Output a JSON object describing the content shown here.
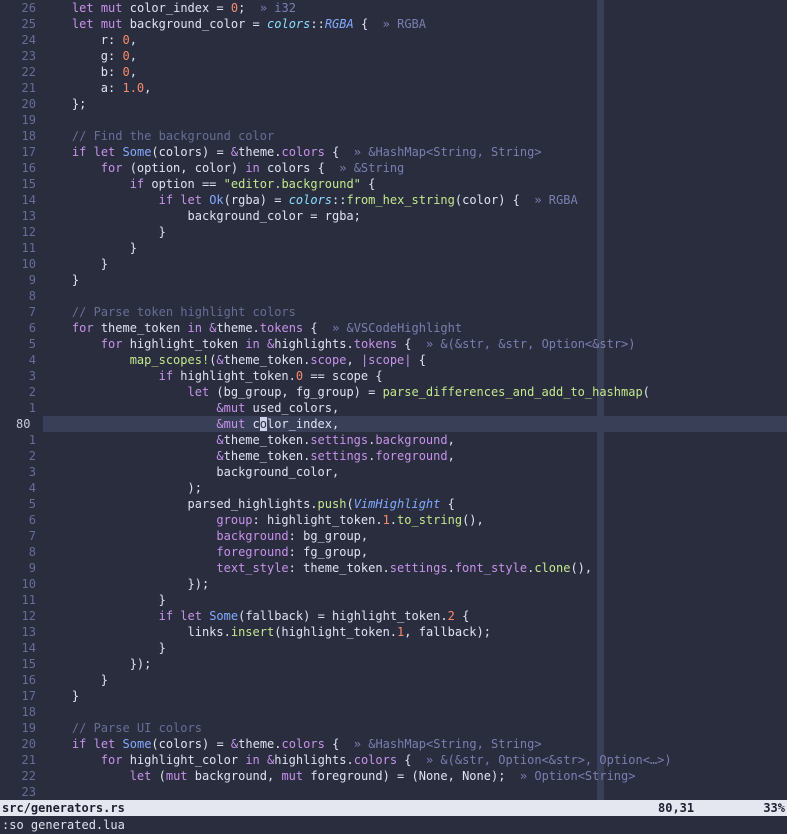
{
  "editor": {
    "lines": [
      {
        "n": "26",
        "segs": [
          [
            "    ",
            "pl"
          ],
          [
            "let",
            "kw"
          ],
          [
            " ",
            "pl"
          ],
          [
            "mut",
            "kw"
          ],
          [
            " color_index = ",
            "pl"
          ],
          [
            "0",
            "nm"
          ],
          [
            ";  ",
            "pl"
          ],
          [
            "» i32",
            "hint"
          ]
        ]
      },
      {
        "n": "25",
        "segs": [
          [
            "    ",
            "pl"
          ],
          [
            "let",
            "kw"
          ],
          [
            " ",
            "pl"
          ],
          [
            "mut",
            "kw"
          ],
          [
            " background_color = ",
            "pl"
          ],
          [
            "colors",
            "ns"
          ],
          [
            "::",
            "pl"
          ],
          [
            "RGBA",
            "ty"
          ],
          [
            " {  ",
            "pl"
          ],
          [
            "» RGBA",
            "hint"
          ]
        ]
      },
      {
        "n": "24",
        "segs": [
          [
            "        r: ",
            "pl"
          ],
          [
            "0",
            "nm"
          ],
          [
            ",",
            "pl"
          ]
        ]
      },
      {
        "n": "23",
        "segs": [
          [
            "        g: ",
            "pl"
          ],
          [
            "0",
            "nm"
          ],
          [
            ",",
            "pl"
          ]
        ]
      },
      {
        "n": "22",
        "segs": [
          [
            "        b: ",
            "pl"
          ],
          [
            "0",
            "nm"
          ],
          [
            ",",
            "pl"
          ]
        ]
      },
      {
        "n": "21",
        "segs": [
          [
            "        a: ",
            "pl"
          ],
          [
            "1.0",
            "nm"
          ],
          [
            ",",
            "pl"
          ]
        ]
      },
      {
        "n": "20",
        "segs": [
          [
            "    };",
            "pl"
          ]
        ]
      },
      {
        "n": "19",
        "segs": []
      },
      {
        "n": "18",
        "segs": [
          [
            "    ",
            "pl"
          ],
          [
            "// Find the background color",
            "cm"
          ]
        ]
      },
      {
        "n": "17",
        "segs": [
          [
            "    ",
            "pl"
          ],
          [
            "if",
            "kw"
          ],
          [
            " ",
            "pl"
          ],
          [
            "let",
            "kw"
          ],
          [
            " ",
            "pl"
          ],
          [
            "Some",
            "fn"
          ],
          [
            "(colors) = ",
            "pl"
          ],
          [
            "&",
            "kw"
          ],
          [
            "theme.",
            "pl"
          ],
          [
            "colors",
            "fld"
          ],
          [
            " {  ",
            "pl"
          ],
          [
            "» &HashMap<String, String>",
            "hint"
          ]
        ]
      },
      {
        "n": "16",
        "segs": [
          [
            "        ",
            "pl"
          ],
          [
            "for",
            "kw"
          ],
          [
            " (option, color) ",
            "pl"
          ],
          [
            "in",
            "kw"
          ],
          [
            " colors {  ",
            "pl"
          ],
          [
            "» &String",
            "hint"
          ]
        ]
      },
      {
        "n": "15",
        "segs": [
          [
            "            ",
            "pl"
          ],
          [
            "if",
            "kw"
          ],
          [
            " option == ",
            "pl"
          ],
          [
            "\"editor.background\"",
            "st"
          ],
          [
            " {",
            "pl"
          ]
        ]
      },
      {
        "n": "14",
        "segs": [
          [
            "                ",
            "pl"
          ],
          [
            "if",
            "kw"
          ],
          [
            " ",
            "pl"
          ],
          [
            "let",
            "kw"
          ],
          [
            " ",
            "pl"
          ],
          [
            "Ok",
            "fn"
          ],
          [
            "(rgba) = ",
            "pl"
          ],
          [
            "colors",
            "ns"
          ],
          [
            "::",
            "pl"
          ],
          [
            "from_hex_string",
            "mth"
          ],
          [
            "(color) {  ",
            "pl"
          ],
          [
            "» RGBA",
            "hint"
          ]
        ]
      },
      {
        "n": "13",
        "segs": [
          [
            "                    background_color = rgba;",
            "pl"
          ]
        ]
      },
      {
        "n": "12",
        "segs": [
          [
            "                }",
            "pl"
          ]
        ]
      },
      {
        "n": "11",
        "segs": [
          [
            "            }",
            "pl"
          ]
        ]
      },
      {
        "n": "10",
        "segs": [
          [
            "        }",
            "pl"
          ]
        ]
      },
      {
        "n": "9",
        "segs": [
          [
            "    }",
            "pl"
          ]
        ]
      },
      {
        "n": "8",
        "segs": []
      },
      {
        "n": "7",
        "segs": [
          [
            "    ",
            "pl"
          ],
          [
            "// Parse token highlight colors",
            "cm"
          ]
        ]
      },
      {
        "n": "6",
        "segs": [
          [
            "    ",
            "pl"
          ],
          [
            "for",
            "kw"
          ],
          [
            " theme_token ",
            "pl"
          ],
          [
            "in",
            "kw"
          ],
          [
            " ",
            "pl"
          ],
          [
            "&",
            "kw"
          ],
          [
            "theme.",
            "pl"
          ],
          [
            "tokens",
            "fld"
          ],
          [
            " {  ",
            "pl"
          ],
          [
            "» &VSCodeHighlight",
            "hint"
          ]
        ]
      },
      {
        "n": "5",
        "segs": [
          [
            "        ",
            "pl"
          ],
          [
            "for",
            "kw"
          ],
          [
            " highlight_token ",
            "pl"
          ],
          [
            "in",
            "kw"
          ],
          [
            " ",
            "pl"
          ],
          [
            "&",
            "kw"
          ],
          [
            "highlights.",
            "pl"
          ],
          [
            "tokens",
            "fld"
          ],
          [
            " {  ",
            "pl"
          ],
          [
            "» &(&str, &str, Option<&str>)",
            "hint"
          ]
        ]
      },
      {
        "n": "4",
        "segs": [
          [
            "            ",
            "pl"
          ],
          [
            "map_scopes!",
            "mac"
          ],
          [
            "(",
            "pl"
          ],
          [
            "&",
            "kw"
          ],
          [
            "theme_token.",
            "pl"
          ],
          [
            "scope",
            "fld"
          ],
          [
            ", ",
            "pl"
          ],
          [
            "|scope|",
            "kw"
          ],
          [
            " {",
            "pl"
          ]
        ]
      },
      {
        "n": "3",
        "segs": [
          [
            "                ",
            "pl"
          ],
          [
            "if",
            "kw"
          ],
          [
            " highlight_token.",
            "pl"
          ],
          [
            "0",
            "nm"
          ],
          [
            " == scope {",
            "pl"
          ]
        ]
      },
      {
        "n": "2",
        "segs": [
          [
            "                    ",
            "pl"
          ],
          [
            "let",
            "kw"
          ],
          [
            " (bg_group, fg_group) = ",
            "pl"
          ],
          [
            "parse_differences_and_add_to_hashmap",
            "mth"
          ],
          [
            "(",
            "pl"
          ]
        ]
      },
      {
        "n": "1",
        "segs": [
          [
            "                        ",
            "pl"
          ],
          [
            "&mut",
            "kw"
          ],
          [
            " used_colors,",
            "pl"
          ]
        ]
      },
      {
        "n": "80",
        "current": true,
        "segs": [
          [
            "                        ",
            "pl"
          ],
          [
            "&mut",
            "kw"
          ],
          [
            " c",
            "pl"
          ],
          [
            "o",
            "cursor"
          ],
          [
            "lor_index,",
            "pl"
          ]
        ]
      },
      {
        "n": "1",
        "segs": [
          [
            "                        ",
            "pl"
          ],
          [
            "&",
            "kw"
          ],
          [
            "theme_token.",
            "pl"
          ],
          [
            "settings",
            "fld"
          ],
          [
            ".",
            "pl"
          ],
          [
            "background",
            "fld"
          ],
          [
            ",",
            "pl"
          ]
        ]
      },
      {
        "n": "2",
        "segs": [
          [
            "                        ",
            "pl"
          ],
          [
            "&",
            "kw"
          ],
          [
            "theme_token.",
            "pl"
          ],
          [
            "settings",
            "fld"
          ],
          [
            ".",
            "pl"
          ],
          [
            "foreground",
            "fld"
          ],
          [
            ",",
            "pl"
          ]
        ]
      },
      {
        "n": "3",
        "segs": [
          [
            "                        background_color,",
            "pl"
          ]
        ]
      },
      {
        "n": "4",
        "segs": [
          [
            "                    );",
            "pl"
          ]
        ]
      },
      {
        "n": "5",
        "segs": [
          [
            "                    parsed_highlights.",
            "pl"
          ],
          [
            "push",
            "mth"
          ],
          [
            "(",
            "pl"
          ],
          [
            "VimHighlight",
            "ty"
          ],
          [
            " {",
            "pl"
          ]
        ]
      },
      {
        "n": "6",
        "segs": [
          [
            "                        ",
            "pl"
          ],
          [
            "group",
            "fld"
          ],
          [
            ": highlight_token.",
            "pl"
          ],
          [
            "1",
            "nm"
          ],
          [
            ".",
            "pl"
          ],
          [
            "to_string",
            "mth"
          ],
          [
            "(),",
            "pl"
          ]
        ]
      },
      {
        "n": "7",
        "segs": [
          [
            "                        ",
            "pl"
          ],
          [
            "background",
            "fld"
          ],
          [
            ": bg_group,",
            "pl"
          ]
        ]
      },
      {
        "n": "8",
        "segs": [
          [
            "                        ",
            "pl"
          ],
          [
            "foreground",
            "fld"
          ],
          [
            ": fg_group,",
            "pl"
          ]
        ]
      },
      {
        "n": "9",
        "segs": [
          [
            "                        ",
            "pl"
          ],
          [
            "text_style",
            "fld"
          ],
          [
            ": theme_token.",
            "pl"
          ],
          [
            "settings",
            "fld"
          ],
          [
            ".",
            "pl"
          ],
          [
            "font_style",
            "fld"
          ],
          [
            ".",
            "pl"
          ],
          [
            "clone",
            "mth"
          ],
          [
            "(),",
            "pl"
          ]
        ]
      },
      {
        "n": "10",
        "segs": [
          [
            "                    });",
            "pl"
          ]
        ]
      },
      {
        "n": "11",
        "segs": [
          [
            "                }",
            "pl"
          ]
        ]
      },
      {
        "n": "12",
        "segs": [
          [
            "                ",
            "pl"
          ],
          [
            "if",
            "kw"
          ],
          [
            " ",
            "pl"
          ],
          [
            "let",
            "kw"
          ],
          [
            " ",
            "pl"
          ],
          [
            "Some",
            "fn"
          ],
          [
            "(fallback) = highlight_token.",
            "pl"
          ],
          [
            "2",
            "nm"
          ],
          [
            " {",
            "pl"
          ]
        ]
      },
      {
        "n": "13",
        "segs": [
          [
            "                    links.",
            "pl"
          ],
          [
            "insert",
            "mth"
          ],
          [
            "(highlight_token.",
            "pl"
          ],
          [
            "1",
            "nm"
          ],
          [
            ", fallback);",
            "pl"
          ]
        ]
      },
      {
        "n": "14",
        "segs": [
          [
            "                }",
            "pl"
          ]
        ]
      },
      {
        "n": "15",
        "segs": [
          [
            "            });",
            "pl"
          ]
        ]
      },
      {
        "n": "16",
        "segs": [
          [
            "        }",
            "pl"
          ]
        ]
      },
      {
        "n": "17",
        "segs": [
          [
            "    }",
            "pl"
          ]
        ]
      },
      {
        "n": "18",
        "segs": []
      },
      {
        "n": "19",
        "segs": [
          [
            "    ",
            "pl"
          ],
          [
            "// Parse UI colors",
            "cm"
          ]
        ]
      },
      {
        "n": "20",
        "segs": [
          [
            "    ",
            "pl"
          ],
          [
            "if",
            "kw"
          ],
          [
            " ",
            "pl"
          ],
          [
            "let",
            "kw"
          ],
          [
            " ",
            "pl"
          ],
          [
            "Some",
            "fn"
          ],
          [
            "(colors) = ",
            "pl"
          ],
          [
            "&",
            "kw"
          ],
          [
            "theme.",
            "pl"
          ],
          [
            "colors",
            "fld"
          ],
          [
            " {  ",
            "pl"
          ],
          [
            "» &HashMap<String, String>",
            "hint"
          ]
        ]
      },
      {
        "n": "21",
        "segs": [
          [
            "        ",
            "pl"
          ],
          [
            "for",
            "kw"
          ],
          [
            " highlight_color ",
            "pl"
          ],
          [
            "in",
            "kw"
          ],
          [
            " ",
            "pl"
          ],
          [
            "&",
            "kw"
          ],
          [
            "highlights.",
            "pl"
          ],
          [
            "colors",
            "fld"
          ],
          [
            " {  ",
            "pl"
          ],
          [
            "» &(&str, Option<&str>, Option<…>)",
            "hint"
          ]
        ]
      },
      {
        "n": "22",
        "segs": [
          [
            "            ",
            "pl"
          ],
          [
            "let",
            "kw"
          ],
          [
            " (",
            "pl"
          ],
          [
            "mut",
            "kw"
          ],
          [
            " background, ",
            "pl"
          ],
          [
            "mut",
            "kw"
          ],
          [
            " foreground) = (None, None);  ",
            "pl"
          ],
          [
            "» Option<String>",
            "hint"
          ]
        ]
      },
      {
        "n": "23",
        "segs": []
      }
    ]
  },
  "statusline": {
    "file": "src/generators.rs",
    "position": "80,31",
    "percent": "33%"
  },
  "cmdline": {
    "text": ":so generated.lua"
  },
  "colors": {
    "background": "#292d3e",
    "keyword": "#c792ea",
    "function": "#82aaff",
    "string": "#c3e88d",
    "number": "#f78c6c",
    "comment": "#676e95",
    "statusline": "#e5e7f0"
  }
}
